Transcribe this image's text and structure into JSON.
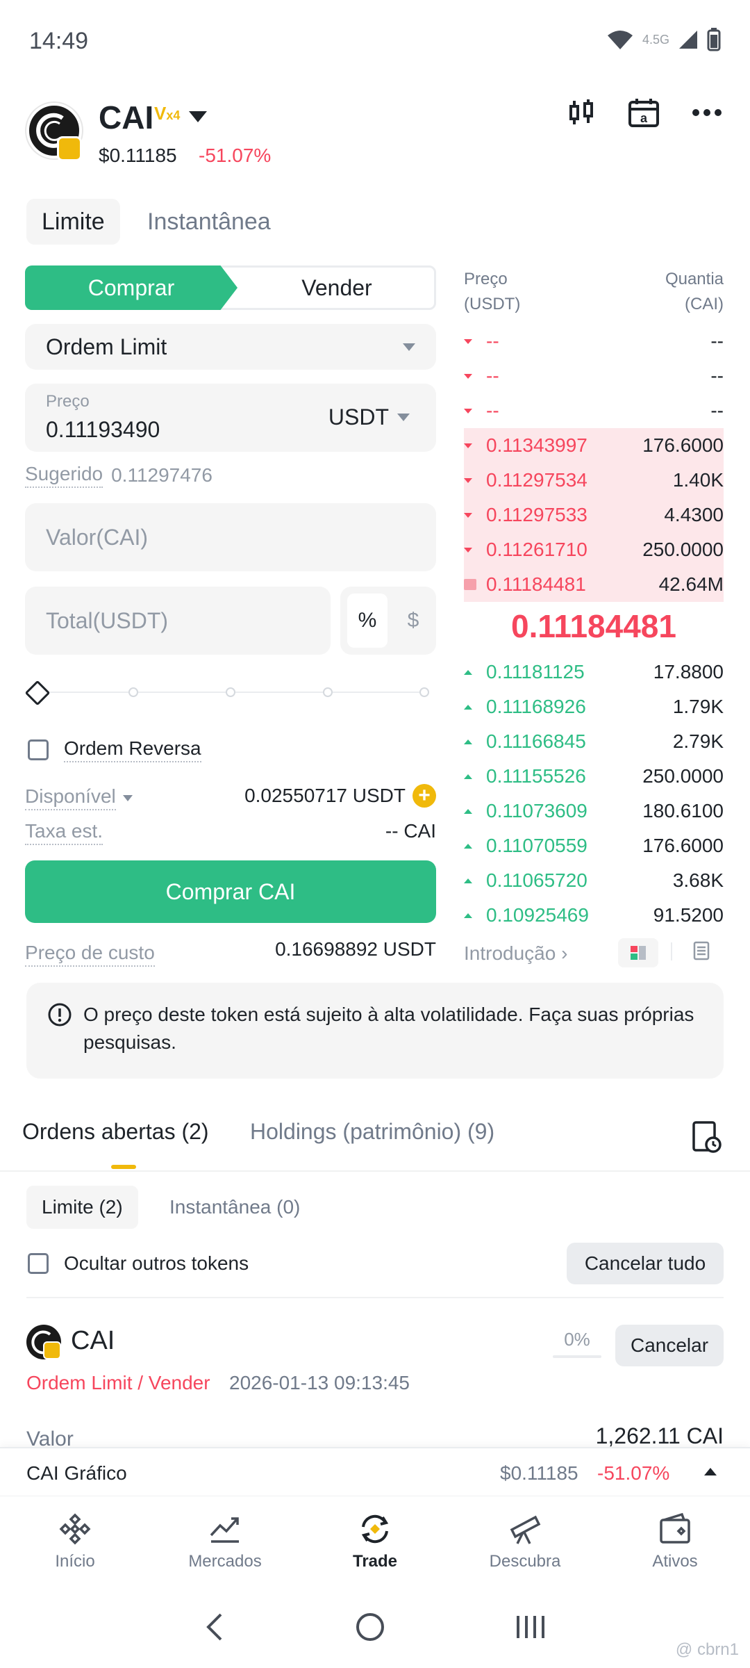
{
  "status_bar": {
    "time": "14:49",
    "network": "4.5G"
  },
  "token": {
    "symbol": "CAI",
    "badge": "x4",
    "price": "$0.11185",
    "change": "-51.07%"
  },
  "order_tabs": [
    "Limite",
    "Instantânea"
  ],
  "side": {
    "buy": "Comprar",
    "sell": "Vender"
  },
  "order_type": "Ordem Limit",
  "price_field": {
    "label": "Preço",
    "value": "0.11193490",
    "currency": "USDT"
  },
  "suggested": {
    "label": "Sugerido",
    "value": "0.11297476"
  },
  "amount_placeholder": "Valor(CAI)",
  "total_placeholder": "Total(USDT)",
  "unit_toggle": {
    "percent": "%",
    "dollar": "$"
  },
  "reverse_order": "Ordem Reversa",
  "available": {
    "label": "Disponível",
    "value": "0.02550717 USDT"
  },
  "fee": {
    "label": "Taxa est.",
    "value": "-- CAI"
  },
  "buy_button": "Comprar CAI",
  "cost_price": {
    "label": "Preço de custo",
    "value": "0.16698892 USDT"
  },
  "orderbook": {
    "header": {
      "price_l1": "Preço",
      "price_l2": "(USDT)",
      "qty_l1": "Quantia",
      "qty_l2": "(CAI)"
    },
    "asks": [
      {
        "price": "--",
        "qty": "--"
      },
      {
        "price": "--",
        "qty": "--"
      },
      {
        "price": "--",
        "qty": "--"
      },
      {
        "price": "0.11343997",
        "qty": "176.6000"
      },
      {
        "price": "0.11297534",
        "qty": "1.40K"
      },
      {
        "price": "0.11297533",
        "qty": "4.4300"
      },
      {
        "price": "0.11261710",
        "qty": "250.0000"
      },
      {
        "price": "0.11184481",
        "qty": "42.64M"
      }
    ],
    "mid_price": "0.11184481",
    "bids": [
      {
        "price": "0.11181125",
        "qty": "17.8800"
      },
      {
        "price": "0.11168926",
        "qty": "1.79K"
      },
      {
        "price": "0.11166845",
        "qty": "2.79K"
      },
      {
        "price": "0.11155526",
        "qty": "250.0000"
      },
      {
        "price": "0.11073609",
        "qty": "180.6100"
      },
      {
        "price": "0.11070559",
        "qty": "176.6000"
      },
      {
        "price": "0.11065720",
        "qty": "3.68K"
      },
      {
        "price": "0.10925469",
        "qty": "91.5200"
      }
    ],
    "intro_link": "Introdução"
  },
  "warning": "O preço deste token está sujeito à alta volatilidade. Faça suas próprias pesquisas.",
  "bottom_tabs": {
    "open_orders": "Ordens abertas (2)",
    "holdings": "Holdings (patrimônio) (9)"
  },
  "sub_tabs": {
    "limit": "Limite (2)",
    "instant": "Instantânea (0)"
  },
  "hide_others": "Ocultar outros tokens",
  "cancel_all": "Cancelar tudo",
  "order": {
    "symbol": "CAI",
    "progress": "0%",
    "cancel": "Cancelar",
    "type": "Ordem Limit / Vender",
    "date": "2026-01-13 09:13:45",
    "value_label": "Valor",
    "value": "1,262.11 CAI"
  },
  "chart_strip": {
    "label": "CAI Gráfico",
    "price": "$0.11185",
    "change": "-51.07%"
  },
  "nav": [
    "Início",
    "Mercados",
    "Trade",
    "Descubra",
    "Ativos"
  ],
  "watermark": "@ cbrn1"
}
